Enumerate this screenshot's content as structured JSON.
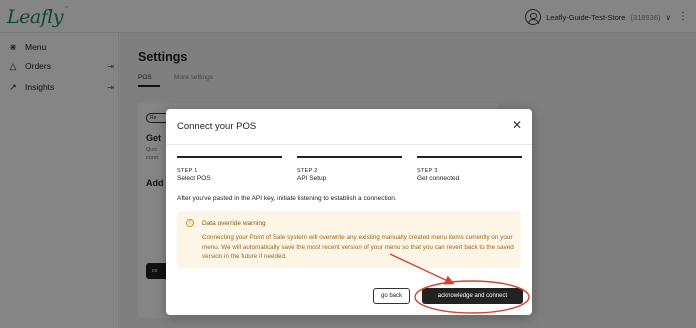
{
  "header": {
    "logo": "Leafly",
    "logo_mark": "™",
    "store_name": "Leafly-Guide-Test-Store",
    "store_id": "(318936)",
    "dropdown_glyph": "∨",
    "more_glyph": "⋮"
  },
  "sidebar": {
    "items": [
      {
        "label": "Menu",
        "icon": "menu-grid-icon",
        "glyph": "⋇"
      },
      {
        "label": "Orders",
        "icon": "bag-icon",
        "glyph": "△",
        "external_glyph": "⇥"
      },
      {
        "label": "Insights",
        "icon": "trend-icon",
        "glyph": "↗",
        "external_glyph": "⇥"
      }
    ]
  },
  "page": {
    "title": "Settings",
    "tabs": [
      {
        "label": "POS",
        "active": true
      },
      {
        "label": "More settings",
        "active": false
      }
    ],
    "card": {
      "chip": "Re",
      "heading": "Get",
      "text": "Quic",
      "text2": "conn",
      "heading2": "Add",
      "button": "co"
    }
  },
  "modal": {
    "title": "Connect your POS",
    "close_glyph": "✕",
    "steps": [
      {
        "number": "STEP 1",
        "name": "Select POS"
      },
      {
        "number": "STEP 2",
        "name": "API Setup"
      },
      {
        "number": "STEP 3",
        "name": "Get connected"
      }
    ],
    "instruction": "After you've pasted in the API key, initiate listening to establish a connection.",
    "warning": {
      "icon_glyph": "!",
      "title": "Data override warning",
      "body": "Connecting your Point of Sale system will overwrite any existing manually created menu items currently on your menu. We will automatically save the most recent version of your menu so that you can revert back to the saved version in the future if needed."
    },
    "buttons": {
      "back": "go back",
      "acknowledge": "acknowledge and connect"
    }
  },
  "colors": {
    "brand": "#1a8a6a",
    "annotation": "#d9412b",
    "warning_bg": "#fdf5e6",
    "warning_text": "#9a6a1a",
    "primary_button": "#222222"
  }
}
